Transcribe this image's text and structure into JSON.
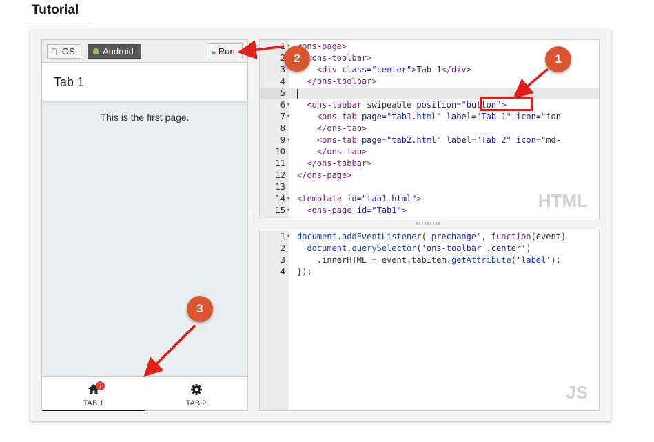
{
  "heading": "Tutorial",
  "preview": {
    "platform_buttons": [
      {
        "label": "iOS",
        "icon": "apple-icon",
        "selected": false
      },
      {
        "label": "Android",
        "icon": "android-icon",
        "selected": true
      }
    ],
    "run_label": "Run",
    "toolbar_title": "Tab 1",
    "page_text": "This is the first page.",
    "tabs": [
      {
        "label": "TAB 1",
        "icon": "home-icon",
        "badge": "7",
        "active": true
      },
      {
        "label": "TAB 2",
        "icon": "gear-icon",
        "active": false
      }
    ]
  },
  "html_editor": {
    "mode_label": "HTML",
    "line_numbers": [
      "1",
      "2",
      "3",
      "4",
      "5",
      "6",
      "7",
      "8",
      "9",
      "10",
      "11",
      "12",
      "13",
      "14",
      "15"
    ],
    "fold_lines": [
      1,
      2,
      6,
      7,
      9,
      14,
      15
    ],
    "active_line": 5,
    "lines": [
      "<ons-page>",
      "  <ons-toolbar>",
      "    <div class=\"center\">Tab 1</div>",
      "  </ons-toolbar>",
      "",
      "  <ons-tabbar swipeable position=\"button\">",
      "    <ons-tab page=\"tab1.html\" label=\"Tab 1\" icon=\"ion",
      "    </ons-tab>",
      "    <ons-tab page=\"tab2.html\" label=\"Tab 2\" icon=\"md-",
      "    </ons-tab>",
      "  </ons-tabbar>",
      "</ons-page>",
      "",
      "<template id=\"tab1.html\">",
      "  <ons-page id=\"Tab1\">"
    ]
  },
  "js_editor": {
    "mode_label": "JS",
    "line_numbers": [
      "1",
      "2",
      "3",
      "4"
    ],
    "fold_lines": [
      1
    ],
    "lines": [
      "document.addEventListener('prechange', function(event)",
      "  document.querySelector('ons-toolbar .center')",
      "    .innerHTML = event.tabItem.getAttribute('label');",
      "});"
    ]
  },
  "callouts": [
    "1",
    "2",
    "3"
  ],
  "colors": {
    "callout": "#d9552f",
    "arrow": "#e0211a",
    "highlight_box": "#e0211a",
    "android_button_bg": "#585858",
    "badge": "#e53935"
  }
}
